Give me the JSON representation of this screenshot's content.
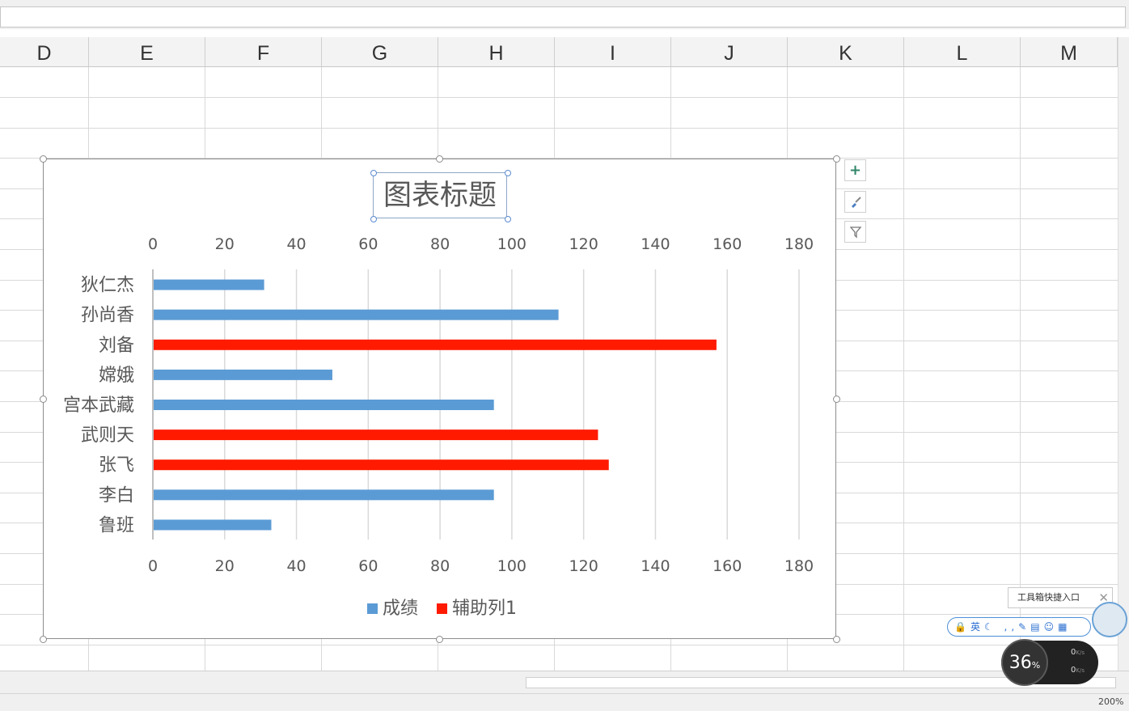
{
  "columns": [
    "D",
    "E",
    "F",
    "G",
    "H",
    "I",
    "J",
    "K",
    "L",
    "M"
  ],
  "chart": {
    "title": "图表标题",
    "side_buttons": {
      "add": "+",
      "styles": "brush",
      "filter": "filter"
    }
  },
  "chart_data": {
    "type": "bar",
    "orientation": "horizontal",
    "title": "图表标题",
    "categories": [
      "狄仁杰",
      "孙尚香",
      "刘备",
      "嫦娥",
      "宫本武藏",
      "武则天",
      "张飞",
      "李白",
      "鲁班"
    ],
    "series": [
      {
        "name": "成绩",
        "color": "#5b9bd5",
        "values": [
          31,
          113,
          null,
          50,
          95,
          null,
          null,
          95,
          33
        ]
      },
      {
        "name": "辅助列1",
        "color": "#ff1a00",
        "values": [
          null,
          null,
          157,
          null,
          null,
          124,
          127,
          null,
          null
        ]
      }
    ],
    "xlim": [
      0,
      180
    ],
    "ticks": [
      0,
      20,
      40,
      60,
      80,
      100,
      120,
      140,
      160,
      180
    ],
    "axis_labels_top_and_bottom": true,
    "grid": "vertical",
    "legend": "bottom"
  },
  "overlay": {
    "toolbox_tip": "工具箱快捷入口",
    "ime_text": "英",
    "cpu_percent": "36",
    "cpu_unit": "%",
    "up_speed": "0",
    "down_speed": "0",
    "speed_unit": "K/s"
  },
  "status": {
    "zoom": "200%"
  }
}
